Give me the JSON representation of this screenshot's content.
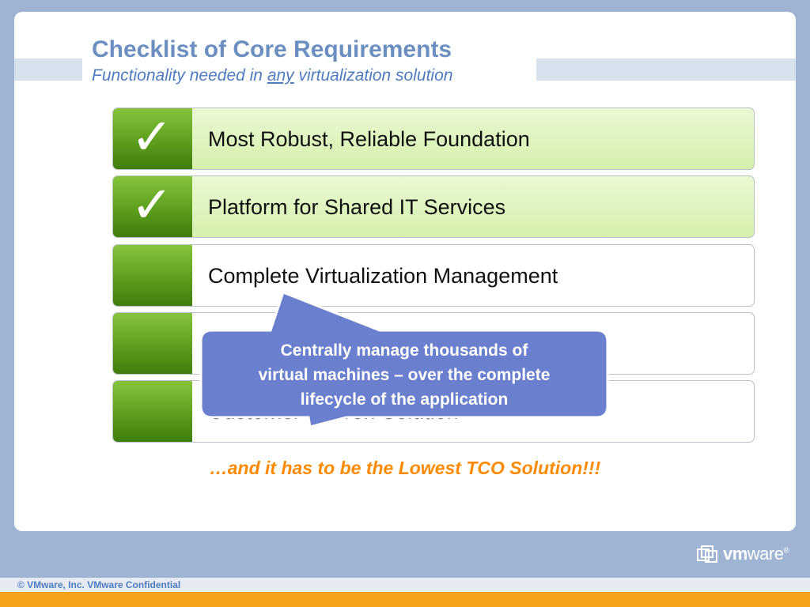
{
  "slide": {
    "title": "Checklist of Core Requirements",
    "subtitle_before": "Functionality needed in ",
    "subtitle_emphasis": "any",
    "subtitle_after": " virtualization solution"
  },
  "requirements": [
    {
      "label": "Most Robust, Reliable Foundation",
      "checked": true
    },
    {
      "label": "Platform for Shared IT Services",
      "checked": true
    },
    {
      "label": "Complete Virtualization Management",
      "checked": false
    },
    {
      "label": "",
      "checked": false
    },
    {
      "label": "Customer-Proven Solution",
      "checked": false
    }
  ],
  "check_glyph": "✓",
  "callout": {
    "line1": "Centrally manage thousands of",
    "line2": "virtual machines – over the complete",
    "line3": "lifecycle of the application",
    "fill_color": "#6b7fcf"
  },
  "tagline": "…and it has to be the Lowest TCO Solution!!!",
  "logo": {
    "icon": "vmware-logo-icon",
    "bold_part": "vm",
    "light_part": "ware",
    "mark": "®"
  },
  "footer": {
    "text": "© VMware, Inc. VMware Confidential"
  },
  "colors": {
    "accent_green": "#5c9e1d",
    "checked_row_bg": "#d5f0ad",
    "title_blue": "#6b8fc1",
    "tagline_orange": "#ff8a00",
    "footer_orange": "#f7a21b",
    "background_blue": "#9fb4d3"
  }
}
